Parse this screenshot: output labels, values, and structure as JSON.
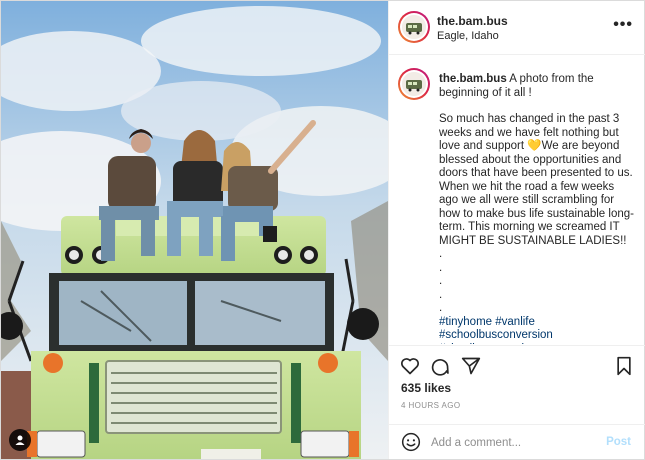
{
  "post": {
    "username": "the.bam.bus",
    "location": "Eagle, Idaho",
    "more_icon": "more-horizontal-icon"
  },
  "caption": {
    "username": "the.bam.bus",
    "intro": "A photo from the beginning of it all !",
    "body_before_emoji": "So much has changed in the past 3 weeks and we have felt nothing but love and support ",
    "emoji": "💛",
    "body_after_emoji": "We are beyond blessed about the opportunities and doors that have been presented to us. When we hit the road a few weeks ago we all were still scrambling for how to make bus life sustainable long-term. This morning we screamed IT MIGHT BE SUSTAINABLE LADIES!!",
    "dots": [
      ".",
      ".",
      ".",
      ".",
      "."
    ],
    "hashtags_line1": "#tinyhome #vanlife",
    "hashtags_line2": "#schoolbusconversion #skoolieconversion"
  },
  "actions": {
    "like_icon": "heart-icon",
    "comment_icon": "comment-icon",
    "share_icon": "share-icon",
    "save_icon": "bookmark-icon"
  },
  "likes": "635 likes",
  "timestamp": "4 HOURS AGO",
  "comment_box": {
    "placeholder": "Add a comment...",
    "post_label": "Post",
    "emoji_icon": "smiley-icon"
  },
  "colors": {
    "link": "#00376b",
    "post_button_disabled": "#b2dffc",
    "bus_body": "#c5e08f",
    "sky": "#8fb9e0"
  }
}
